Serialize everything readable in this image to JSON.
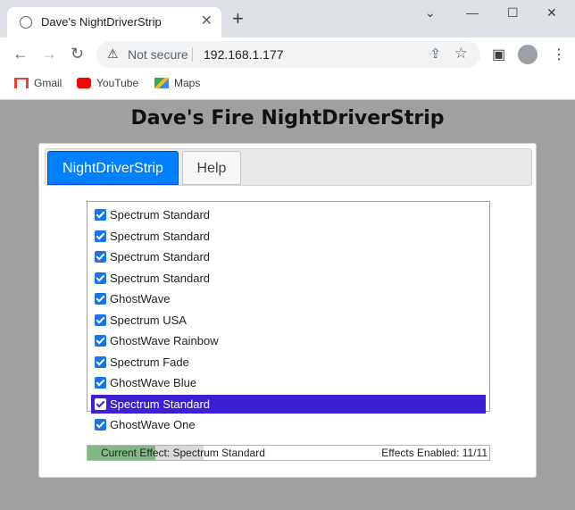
{
  "browser": {
    "tab_title": "Dave's NightDriverStrip",
    "tab_favicon": "globe-icon",
    "new_tab_label": "+",
    "security_text": "Not secure",
    "url": "192.168.1.177",
    "bookmarks": [
      {
        "label": "Gmail",
        "icon": "gmail-icon"
      },
      {
        "label": "YouTube",
        "icon": "youtube-icon"
      },
      {
        "label": "Maps",
        "icon": "maps-icon"
      }
    ]
  },
  "page": {
    "title": "Dave's Fire NightDriverStrip",
    "tabs": [
      {
        "label": "NightDriverStrip",
        "active": true
      },
      {
        "label": "Help",
        "active": false
      }
    ],
    "effects": [
      {
        "label": "Spectrum Standard",
        "checked": true,
        "selected": false
      },
      {
        "label": "Spectrum Standard",
        "checked": true,
        "selected": false
      },
      {
        "label": "Spectrum Standard",
        "checked": true,
        "selected": false
      },
      {
        "label": "Spectrum Standard",
        "checked": true,
        "selected": false
      },
      {
        "label": "GhostWave",
        "checked": true,
        "selected": false
      },
      {
        "label": "Spectrum USA",
        "checked": true,
        "selected": false
      },
      {
        "label": "GhostWave Rainbow",
        "checked": true,
        "selected": false
      },
      {
        "label": "Spectrum Fade",
        "checked": true,
        "selected": false
      },
      {
        "label": "GhostWave Blue",
        "checked": true,
        "selected": false
      },
      {
        "label": "Spectrum Standard",
        "checked": true,
        "selected": true
      },
      {
        "label": "GhostWave One",
        "checked": true,
        "selected": false
      }
    ],
    "status": {
      "current_effect": "Current Effect: Spectrum Standard",
      "effects_enabled": "Effects Enabled: 11/11",
      "progress_fraction": 0.37
    }
  },
  "colors": {
    "tab_active": "#007fff",
    "selected_row": "#3f1fd3",
    "progress": "#7fb986",
    "page_bg": "#a0a0a0"
  }
}
